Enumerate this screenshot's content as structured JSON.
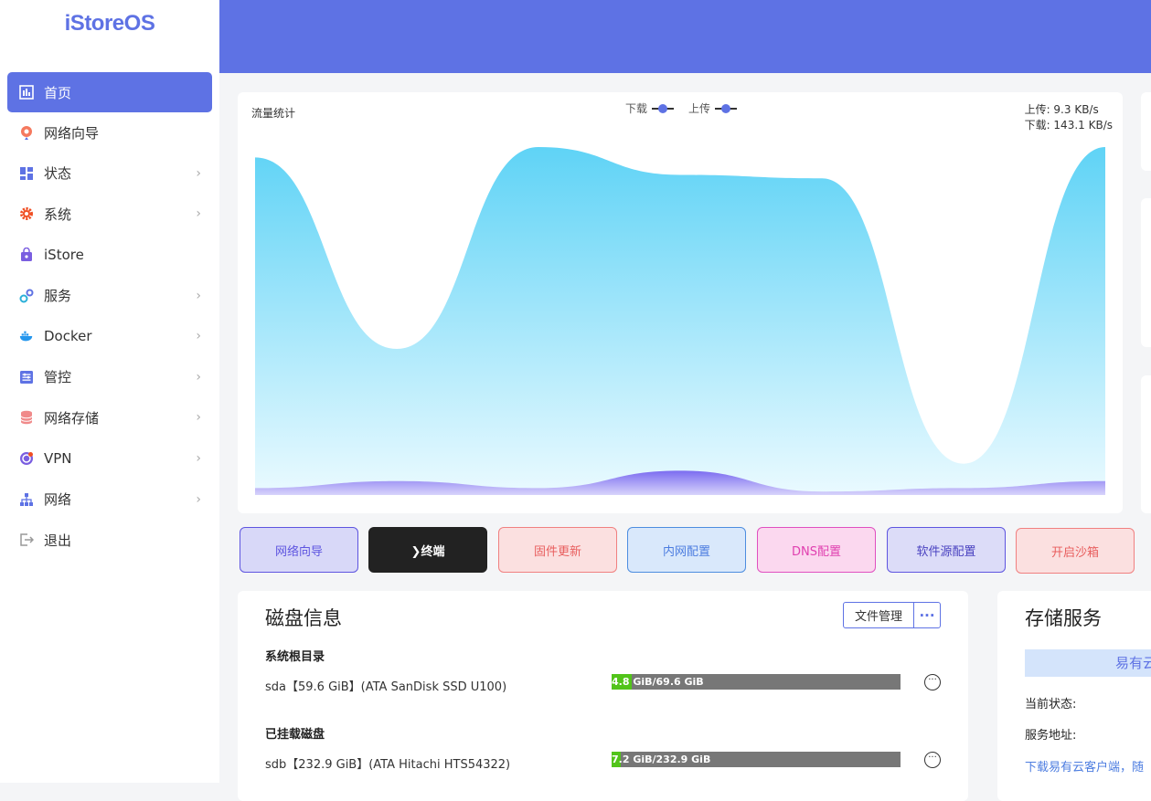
{
  "app": {
    "logo": "iStoreOS"
  },
  "sidebar": {
    "items": [
      {
        "label": "首页",
        "icon": "dashboard-icon",
        "active": true,
        "arrow": false
      },
      {
        "label": "网络向导",
        "icon": "network-guide-icon",
        "arrow": false
      },
      {
        "label": "状态",
        "icon": "status-grid-icon",
        "arrow": true
      },
      {
        "label": "系统",
        "icon": "gear-icon",
        "arrow": true
      },
      {
        "label": "iStore",
        "icon": "store-bag-icon",
        "arrow": false
      },
      {
        "label": "服务",
        "icon": "services-icon",
        "arrow": true
      },
      {
        "label": "Docker",
        "icon": "docker-icon",
        "arrow": true
      },
      {
        "label": "管控",
        "icon": "control-icon",
        "arrow": true
      },
      {
        "label": "网络存储",
        "icon": "storage-db-icon",
        "arrow": true
      },
      {
        "label": "VPN",
        "icon": "vpn-icon",
        "arrow": true
      },
      {
        "label": "网络",
        "icon": "network-tree-icon",
        "arrow": true
      },
      {
        "label": "退出",
        "icon": "logout-icon",
        "arrow": false
      }
    ],
    "arrow_glyph": "›"
  },
  "traffic": {
    "title": "流量统计",
    "legend_download": "下载",
    "legend_upload": "上传",
    "upload_rate": "上传: 9.3 KB/s",
    "download_rate": "下载: 143.1 KB/s",
    "accent": "#5e72e4"
  },
  "chart_data": {
    "type": "area",
    "series": [
      {
        "name": "下载",
        "values": [
          0.97,
          0.42,
          1.0,
          0.92,
          0.91,
          0.09,
          1.0
        ]
      },
      {
        "name": "上传",
        "values": [
          0.02,
          0.04,
          0.02,
          0.07,
          0.01,
          0.02,
          0.04
        ]
      }
    ],
    "grid": false
  },
  "quick_buttons": [
    {
      "label": "网络向导",
      "bg": "#d8d8f8",
      "border": "#5e55e0",
      "color": "#5e55e0"
    },
    {
      "label": "❯终端",
      "bg": "#222222",
      "border": "#222222",
      "color": "#ffffff"
    },
    {
      "label": "固件更新",
      "bg": "#fbe0e0",
      "border": "#f08080",
      "color": "#e85e5e"
    },
    {
      "label": "内网配置",
      "bg": "#d9e8fb",
      "border": "#4d8de0",
      "color": "#4d7de0"
    },
    {
      "label": "DNS配置",
      "bg": "#fbd8ef",
      "border": "#e050c0",
      "color": "#e040b0"
    },
    {
      "label": "软件源配置",
      "bg": "#dcdcf8",
      "border": "#5e55e0",
      "color": "#4a42c0"
    },
    {
      "label": "开启沙箱",
      "bg": "#fbe0e0",
      "border": "#f08080",
      "color": "#e85e5e"
    }
  ],
  "disk": {
    "title": "磁盘信息",
    "file_manager": "文件管理",
    "more": "···",
    "root_label": "系统根目录",
    "mounted_label": "已挂载磁盘",
    "disks": [
      {
        "name": "sda【59.6 GiB】(ATA SanDisk SSD U100)",
        "usage": "4.8 GiB/69.6 GiB",
        "fraction": 0.069
      },
      {
        "name": "sdb【232.9 GiB】(ATA Hitachi HTS54322)",
        "usage": "7.2 GiB/232.9 GiB",
        "fraction": 0.031
      }
    ],
    "row_menu": "···"
  },
  "storage": {
    "title": "存储服务",
    "banner": "易有云",
    "status_label": "当前状态:",
    "address_label": "服务地址:",
    "download_link": "下载易有云客户端，随"
  }
}
